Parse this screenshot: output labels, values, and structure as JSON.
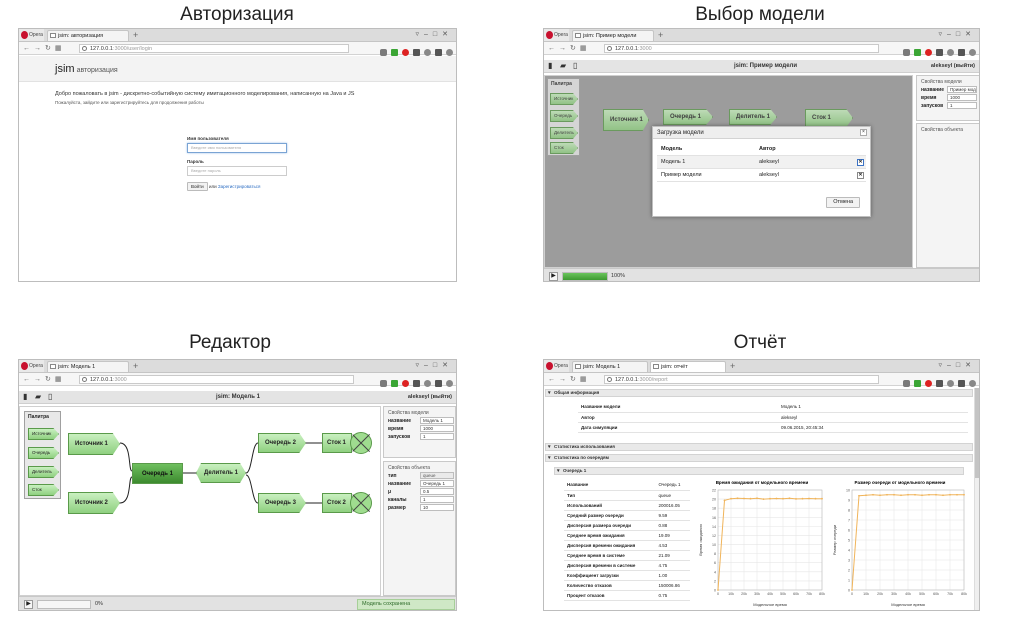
{
  "titles": {
    "login": "Авторизация",
    "model_select": "Выбор модели",
    "editor": "Редактор",
    "report": "Отчёт"
  },
  "browser": {
    "opera_label": "Opera",
    "icons": [
      "heart-icon",
      "plus-green-icon",
      "stop-red-icon",
      "extension-icon",
      "no-icon",
      "menu-icon",
      "user-icon"
    ]
  },
  "login": {
    "tab": "jsim: авторизация",
    "url_host": "127.0.0.1",
    "url_path": ":3000/user/login",
    "logo": "jsim",
    "logo_sub": "авторизация",
    "welcome": "Добро пожаловать в jsim - дискретно-событийную систему имитационного моделирования, написанную на Java и JS",
    "hint": "Пожалуйста, зайдите или зарегистрируйтесь для продолжения работы",
    "username_label": "Имя пользователя",
    "username_placeholder": "Введите имя пользователя",
    "password_label": "Пароль",
    "password_placeholder": "Введите пароль",
    "login_button": "Войти",
    "or_text": "или",
    "register_link": "Зарегистрироваться"
  },
  "model_select": {
    "tab": "jsim: Пример модели",
    "url_host": "127.0.0.1",
    "url_path": ":3000",
    "app_title": "jsim: Пример модели",
    "user": "alekseyl (выйти)",
    "palette_title": "Палитра",
    "palette": [
      "Источник",
      "Очередь",
      "Делитель",
      "Сток"
    ],
    "nodes": [
      "Источник 1",
      "Очередь 1",
      "Делитель 1",
      "Сток 1"
    ],
    "props_title": "Свойства модели",
    "props": [
      {
        "k": "название",
        "v": "Пример мод"
      },
      {
        "k": "время",
        "v": "1000"
      },
      {
        "k": "запусков",
        "v": "1"
      }
    ],
    "obj_props_title": "Свойства объекта",
    "dialog": {
      "title": "Загрузка модели",
      "col_model": "Модель",
      "col_author": "Автор",
      "rows": [
        {
          "model": "Модель 1",
          "author": "alekseyl"
        },
        {
          "model": "Пример модели",
          "author": "alekseyl"
        }
      ],
      "cancel": "Отмена"
    },
    "progress_pct": "100%",
    "progress_value": 1.0
  },
  "editor": {
    "tab": "jsim: Модель 1",
    "url_host": "127.0.0.1",
    "url_path": ":3000",
    "app_title": "jsim: Модель 1",
    "user": "alekseyl (выйти)",
    "palette_title": "Палитра",
    "palette": [
      "Источник",
      "Очередь",
      "Делитель",
      "Сток"
    ],
    "nodes": {
      "src1": "Источник 1",
      "src2": "Источник 2",
      "queue1": "Очередь 1",
      "split1": "Делитель 1",
      "queue2": "Очередь 2",
      "queue3": "Очередь 3",
      "sink1": "Сток 1",
      "sink2": "Сток 2"
    },
    "model_props_title": "Свойства модели",
    "model_props": [
      {
        "k": "название",
        "v": "Модель 1"
      },
      {
        "k": "время",
        "v": "1000"
      },
      {
        "k": "запусков",
        "v": "1"
      }
    ],
    "obj_props_title": "Свойства объекта",
    "obj_props": [
      {
        "k": "тип",
        "v": "queue",
        "ro": true
      },
      {
        "k": "название",
        "v": "Очередь 1"
      },
      {
        "k": "μ",
        "v": "0.5"
      },
      {
        "k": "каналы",
        "v": "1"
      },
      {
        "k": "размер",
        "v": "10"
      }
    ],
    "progress_pct": "0%",
    "progress_value": 0.0,
    "status": "Модель сохранена"
  },
  "report": {
    "tab1": "jsim: Модель 1",
    "tab2": "jsim: отчёт",
    "url_host": "127.0.0.1",
    "url_path": ":3000/report",
    "general_title": "Общая информация",
    "general": [
      {
        "k": "Название модели",
        "v": "Модель 1"
      },
      {
        "k": "Автор",
        "v": "alekseyl"
      },
      {
        "k": "Дата симуляции",
        "v": "09.06.2015, 20:45:34"
      }
    ],
    "usage_title": "Статистика использования",
    "queues_title": "Статистика по очередям",
    "queue1_title": "Очередь 1",
    "queue_stats": [
      {
        "k": "Название",
        "v": "Очередь 1"
      },
      {
        "k": "Тип",
        "v": "queue"
      },
      {
        "k": "Использований",
        "v": "200016.05"
      },
      {
        "k": "Средний размер очереди",
        "v": "9.59"
      },
      {
        "k": "Дисперсия размера очереди",
        "v": "0.88"
      },
      {
        "k": "Среднее время ожидания",
        "v": "19.09"
      },
      {
        "k": "Дисперсия времени ожидания",
        "v": "4.53"
      },
      {
        "k": "Среднее время в системе",
        "v": "21.09"
      },
      {
        "k": "Дисперсия времени в системе",
        "v": "4.75"
      },
      {
        "k": "Коэффициент загрузки",
        "v": "1.00"
      },
      {
        "k": "Количество отказов",
        "v": "150006.86"
      },
      {
        "k": "Процент отказов",
        "v": "0.75"
      }
    ]
  },
  "chart_data": [
    {
      "type": "line",
      "title": "Время ожидания от модельного времени",
      "xlabel": "Модельное время",
      "ylabel": "Время ожидания",
      "x": [
        0,
        50,
        100,
        150,
        200,
        250,
        300,
        350,
        400,
        450,
        500,
        550,
        600,
        650,
        700,
        750,
        800
      ],
      "series": [
        {
          "values": [
            0,
            20.6,
            21.0,
            21.1,
            21.05,
            21.0,
            21.1,
            20.9,
            21.0,
            21.05,
            21.0,
            21.1,
            20.95,
            21.0,
            21.05,
            21.0,
            21.0
          ]
        }
      ],
      "xticks": [
        "0",
        "10k",
        "20k",
        "30k",
        "40k",
        "50k",
        "60k",
        "70k",
        "80k"
      ],
      "yticks": [
        "0",
        "2",
        "4",
        "6",
        "8",
        "10",
        "12",
        "14",
        "16",
        "18",
        "20",
        "22"
      ],
      "ylim": [
        0,
        23
      ],
      "color": "#f0b45a"
    },
    {
      "type": "line",
      "title": "Размер очереди от модельного времени",
      "xlabel": "Модельное время",
      "ylabel": "Размер очереди",
      "x": [
        0,
        50,
        100,
        150,
        200,
        250,
        300,
        350,
        400,
        450,
        500,
        550,
        600,
        650,
        700,
        750,
        800
      ],
      "series": [
        {
          "values": [
            0,
            9.9,
            9.95,
            10,
            9.95,
            10,
            10,
            9.95,
            10,
            10,
            9.95,
            10,
            10,
            9.95,
            10,
            10,
            10
          ]
        }
      ],
      "xticks": [
        "0",
        "10k",
        "20k",
        "30k",
        "40k",
        "50k",
        "60k",
        "70k",
        "80k"
      ],
      "yticks": [
        "0",
        "1",
        "2",
        "3",
        "4",
        "5",
        "6",
        "7",
        "8",
        "9",
        "10"
      ],
      "ylim": [
        0,
        10.5
      ],
      "color": "#f0b45a"
    }
  ]
}
